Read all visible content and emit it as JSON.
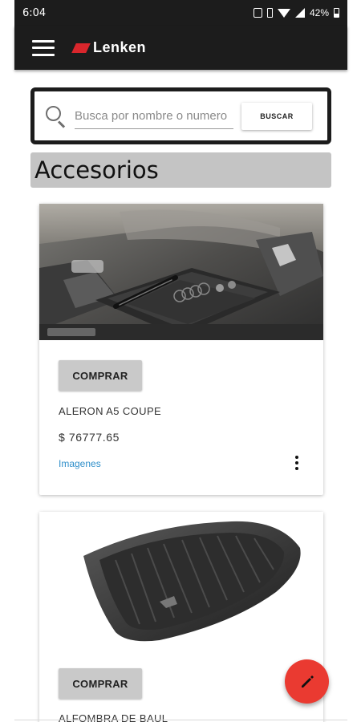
{
  "status_bar": {
    "time": "6:04",
    "battery": "42%",
    "icons": [
      "nfc-icon",
      "vibrate-icon",
      "wifi-icon",
      "signal-icon",
      "battery-icon"
    ]
  },
  "app_bar": {
    "brand": "Lenken",
    "brand_color": "#d9262c",
    "background": "#1c1c1c",
    "icons": [
      "menu-icon",
      "brand-logo-icon"
    ]
  },
  "search": {
    "placeholder": "Busca por nombre o numero",
    "value": "",
    "button_label": "BUSCAR",
    "icons": [
      "search-icon"
    ]
  },
  "section": {
    "title": "Accesorios"
  },
  "products": [
    {
      "buy_label": "COMPRAR",
      "name": "ALERON A5 COUPE",
      "price": "$ 76777.65",
      "images_link": "Imagenes",
      "image_icon": "car-interior-notebook-image"
    },
    {
      "buy_label": "COMPRAR",
      "name": "ALFOMBRA DE BAUL",
      "image_icon": "trunk-mat-image"
    }
  ],
  "fab": {
    "icon": "pencil-icon",
    "color": "#ea3a31"
  },
  "colors": {
    "link": "#2f8fca",
    "section_bg": "#c4c4c4",
    "button_bg": "#c9c9c9"
  }
}
